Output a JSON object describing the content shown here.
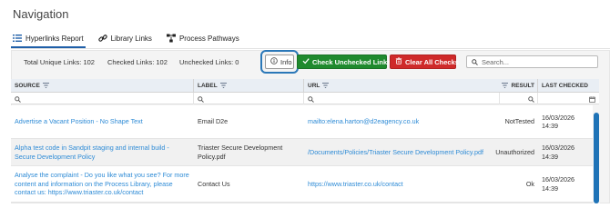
{
  "page": {
    "title": "Navigation"
  },
  "tabs": [
    {
      "label": "Hyperlinks Report",
      "icon": "list-icon",
      "active": true
    },
    {
      "label": "Library Links",
      "icon": "link-icon",
      "active": false
    },
    {
      "label": "Process Pathways",
      "icon": "process-icon",
      "active": false
    }
  ],
  "stats": {
    "total": "Total Unique Links: 102",
    "checked": "Checked Links: 102",
    "unchecked": "Unchecked Links: 0"
  },
  "toolbar": {
    "info_label": "Info",
    "check_label": "Check Unchecked Links",
    "clear_label": "Clear All Checks",
    "search_placeholder": "Search..."
  },
  "colors": {
    "accent": "#1f5fa8",
    "link": "#2e8bd6",
    "success": "#1f8a2e",
    "danger": "#cf2a2a",
    "highlight": "#2b78b8"
  },
  "columns": [
    "SOURCE",
    "LABEL",
    "URL",
    "RESULT",
    "LAST CHECKED"
  ],
  "rows": [
    {
      "source": "Advertise a Vacant Position - No Shape Text",
      "label": "Email D2e",
      "url": "mailto:elena.harton@d2eagency.co.uk",
      "result": "NotTested",
      "date": "16/03/2026",
      "time": "14:39"
    },
    {
      "source": "Alpha test code in Sandpit staging and internal build - Secure Development Policy",
      "label": "Triaster Secure Development Policy.pdf",
      "url": "/Documents/Policies/Triaster Secure Development Policy.pdf",
      "result": "Unauthorized",
      "date": "16/03/2026",
      "time": "14:39"
    },
    {
      "source": "Analyse the complaint - Do you like what you see? For more content and information on the Process Library, please contact us: https://www.triaster.co.uk/contact",
      "label": "Contact Us",
      "url": "https://www.triaster.co.uk/contact",
      "result": "Ok",
      "date": "16/03/2026",
      "time": "14:39"
    }
  ]
}
